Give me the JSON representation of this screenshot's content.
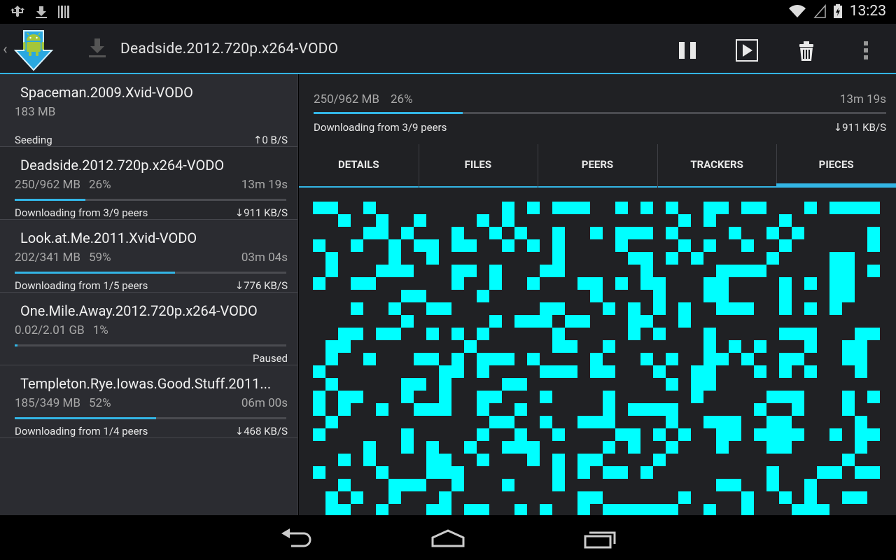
{
  "status_bar": {
    "time": "13:23",
    "left_icons": [
      "usb-debug-icon",
      "download-notification-icon",
      "barcode-icon"
    ],
    "right_icons": [
      "wifi-icon",
      "no-signal-icon",
      "battery-charging-icon"
    ]
  },
  "action_bar": {
    "title": "Deadside.2012.720p.x264-VODO",
    "up_indicator": "‹",
    "actions": [
      "pause-icon",
      "play-icon",
      "trash-icon",
      "overflow-menu-icon"
    ]
  },
  "torrents": [
    {
      "name": "Spaceman.2009.Xvid-VODO",
      "size": "183 MB",
      "percent": "",
      "eta": "",
      "progress": 0,
      "status": "Seeding",
      "speed": "↑0 B/S"
    },
    {
      "name": "Deadside.2012.720p.x264-VODO",
      "size": "250/962 MB",
      "percent": "26%",
      "eta": "13m 19s",
      "progress": 0.26,
      "status": "Downloading from 3/9 peers",
      "speed": "↓911 KB/S"
    },
    {
      "name": "Look.at.Me.2011.Xvid-VODO",
      "size": "202/341 MB",
      "percent": "59%",
      "eta": "03m 04s",
      "progress": 0.59,
      "status": "Downloading from 1/5 peers",
      "speed": "↓776 KB/S"
    },
    {
      "name": "One.Mile.Away.2012.720p.x264-VODO",
      "size": "0.02/2.01 GB",
      "percent": "1%",
      "eta": "",
      "progress": 0.01,
      "status": "",
      "speed": "Paused"
    },
    {
      "name": "Templeton.Rye.Iowas.Good.Stuff.2011...",
      "size": "185/349 MB",
      "percent": "52%",
      "eta": "06m 00s",
      "progress": 0.52,
      "status": "Downloading from 1/4 peers",
      "speed": "↓468 KB/S"
    }
  ],
  "detail": {
    "size": "250/962 MB",
    "percent": "26%",
    "eta": "13m 19s",
    "progress": 0.26,
    "status": "Downloading from 3/9 peers",
    "speed": "↓911 KB/S",
    "tabs": [
      "DETAILS",
      "FILES",
      "PEERS",
      "TRACKERS",
      "PIECES"
    ],
    "active_tab": "PIECES",
    "pieces_color": "#00ffff"
  },
  "nav_bar": [
    "back-icon",
    "home-icon",
    "recents-icon"
  ]
}
